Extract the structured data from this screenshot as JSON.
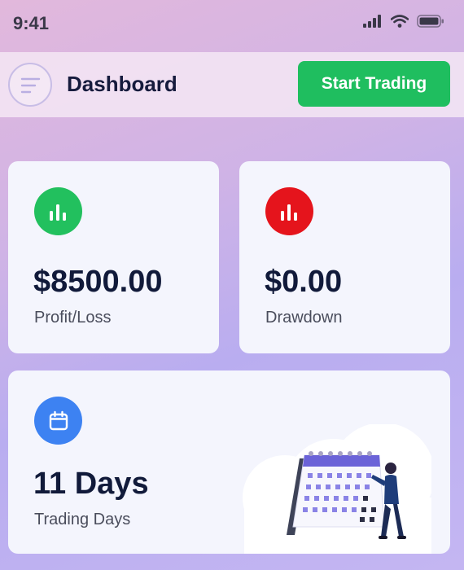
{
  "status_bar": {
    "time": "9:41",
    "icons": [
      "cellular-signal-icon",
      "wifi-icon",
      "battery-icon"
    ]
  },
  "header": {
    "menu_icon": "menu-icon",
    "title": "Dashboard",
    "start_button_label": "Start Trading"
  },
  "cards": {
    "profit": {
      "value": "$8500.00",
      "label": "Profit/Loss",
      "icon": "bar-chart-icon",
      "icon_color": "#22c05e"
    },
    "drawdown": {
      "value": "$0.00",
      "label": "Drawdown",
      "icon": "bar-chart-icon",
      "icon_color": "#e5141c"
    },
    "days": {
      "value": "11 Days",
      "label": "Trading Days",
      "icon": "calendar-icon",
      "icon_color": "#3d82f2"
    }
  },
  "colors": {
    "accent_green": "#1fbe5f",
    "danger_red": "#e5141c",
    "info_blue": "#3d82f2",
    "text_dark": "#131b3a"
  }
}
